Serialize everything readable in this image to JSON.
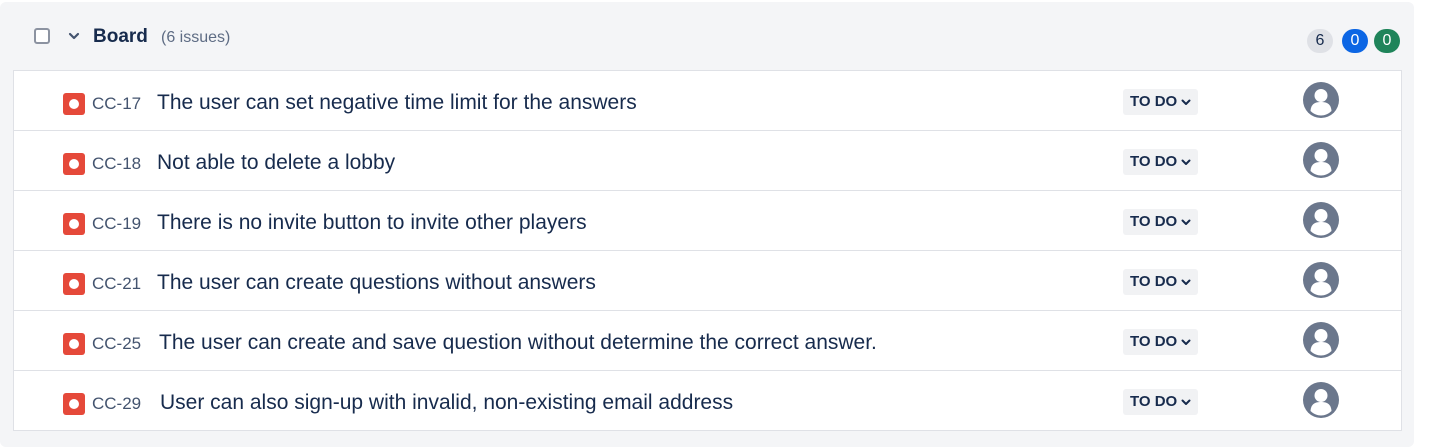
{
  "board": {
    "title": "Board",
    "issue_count": "(6 issues)",
    "status_counts": {
      "todo": "6",
      "in_progress": "0",
      "done": "0"
    }
  },
  "issues": [
    {
      "key": "CC-17",
      "summary": "The user can set negative time limit for the answers",
      "status": "TO DO",
      "type_icon": "bug-icon",
      "assignee": "unassigned"
    },
    {
      "key": "CC-18",
      "summary": "Not able to delete a lobby",
      "status": "TO DO",
      "type_icon": "bug-icon",
      "assignee": "unassigned"
    },
    {
      "key": "CC-19",
      "summary": "There is no invite button to invite other players",
      "status": "TO DO",
      "type_icon": "bug-icon",
      "assignee": "unassigned"
    },
    {
      "key": "CC-21",
      "summary": "The user can create questions without answers",
      "status": "TO DO",
      "type_icon": "bug-icon",
      "assignee": "unassigned"
    },
    {
      "key": "CC-25",
      "summary": "The user can create and save question without determine the correct answer.",
      "status": "TO DO",
      "type_icon": "bug-icon",
      "assignee": "unassigned"
    },
    {
      "key": "CC-29",
      "summary": "User can also sign-up with invalid, non-existing email address",
      "status": "TO DO",
      "type_icon": "bug-icon",
      "assignee": "unassigned"
    }
  ],
  "colors": {
    "bug": "#e5493a",
    "badge_todo": "#dfe1e6",
    "badge_in_progress": "#0c66e4",
    "badge_done": "#1f845a"
  }
}
